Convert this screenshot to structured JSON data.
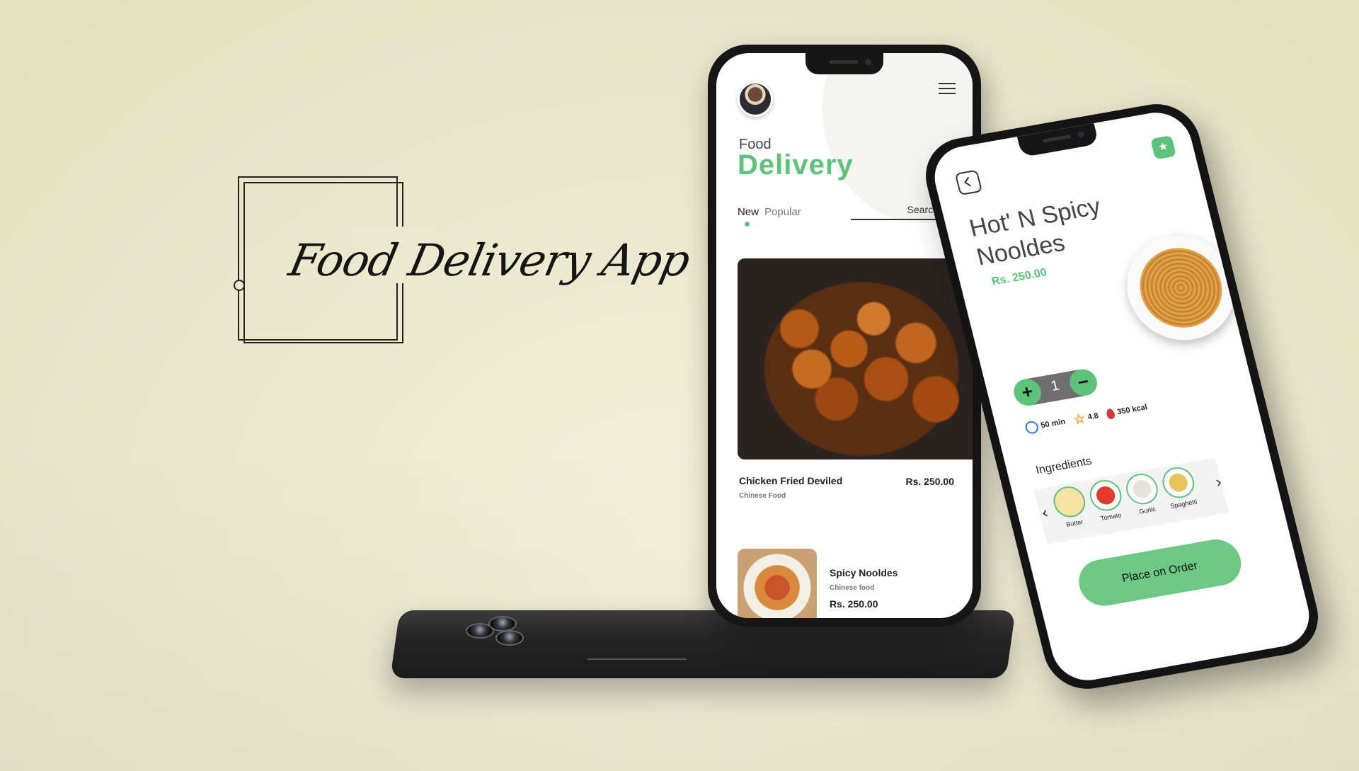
{
  "brand": {
    "logo_text": "Food Delivery App"
  },
  "colors": {
    "accent": "#5dc27a",
    "background": "#ece9cf",
    "device": "#161616"
  },
  "home_screen": {
    "avatar_icon": "user-avatar",
    "menu_icon": "hamburger-menu-icon",
    "title_small": "Food",
    "title_big": "Delivery",
    "tabs": [
      {
        "label": "New",
        "active": true
      },
      {
        "label": "Popular",
        "active": false
      }
    ],
    "search": {
      "placeholder": "Search",
      "icon": "search-icon"
    },
    "items": [
      {
        "name": "Chicken Fried Deviled",
        "category": "Chinese Food",
        "price": "Rs. 250.00"
      },
      {
        "name": "Spicy Nooldes",
        "category": "Chinese food",
        "price": "Rs. 250.00"
      }
    ]
  },
  "detail_screen": {
    "back_icon": "chevron-left-icon",
    "favorite_icon": "star-icon",
    "title": "Hot' N Spicy Nooldes",
    "price": "Rs. 250.00",
    "quantity": "1",
    "plus_label": "+",
    "minus_label": "−",
    "stats": {
      "time": "50 min",
      "rating": "4.8",
      "calories": "350 kcal"
    },
    "ingredients_title": "Ingredients",
    "ingredients": [
      "Butter",
      "Tomato",
      "Gurlic",
      "Spaghetti"
    ],
    "order_button": "Place on Order"
  }
}
